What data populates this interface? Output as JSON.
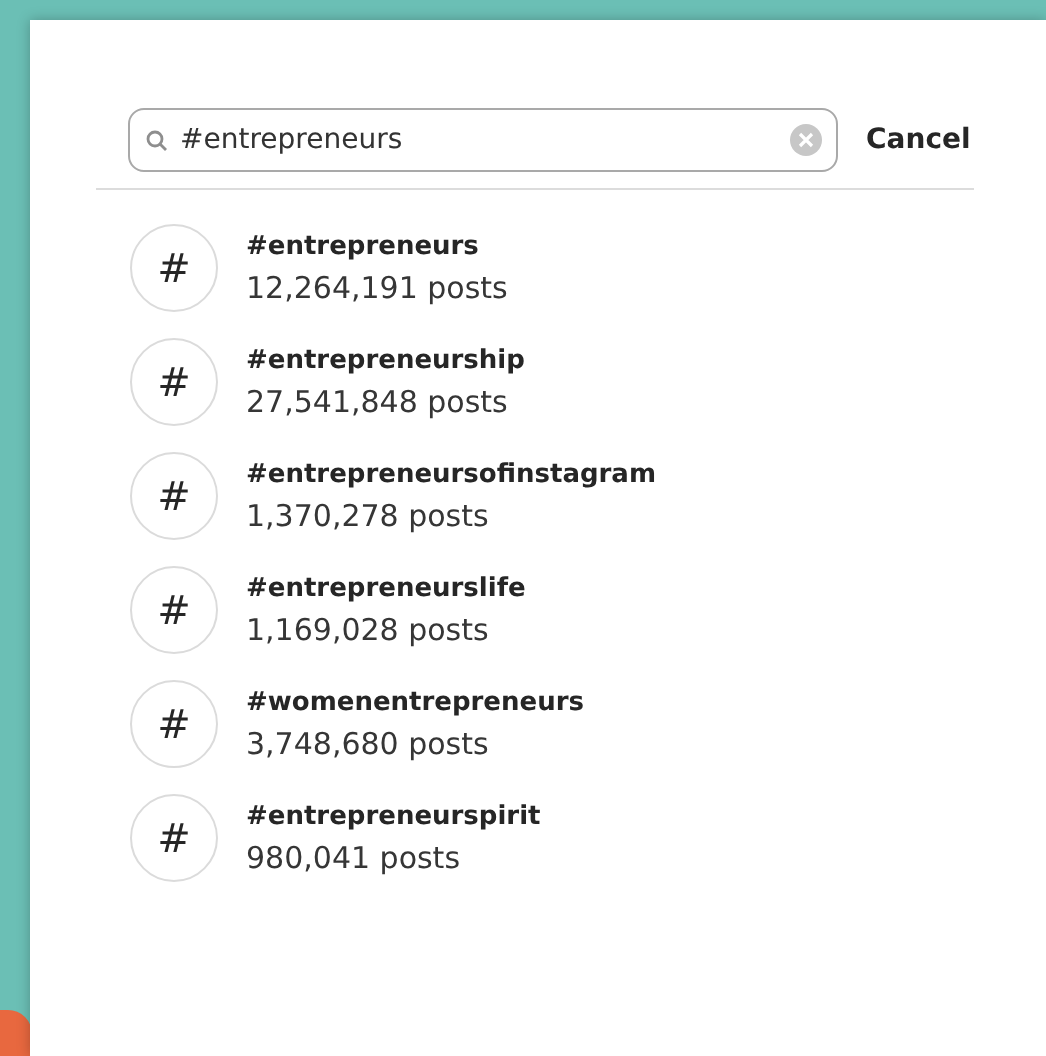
{
  "search": {
    "value": "#entrepreneurs",
    "cancel": "Cancel"
  },
  "results": [
    {
      "symbol": "#",
      "tag": "#entrepreneurs",
      "posts": "12,264,191 posts"
    },
    {
      "symbol": "#",
      "tag": "#entrepreneurship",
      "posts": "27,541,848 posts"
    },
    {
      "symbol": "#",
      "tag": "#entrepreneursofinstagram",
      "posts": "1,370,278 posts"
    },
    {
      "symbol": "#",
      "tag": "#entrepreneurslife",
      "posts": "1,169,028 posts"
    },
    {
      "symbol": "#",
      "tag": "#womenentrepreneurs",
      "posts": "3,748,680 posts"
    },
    {
      "symbol": "#",
      "tag": "#entrepreneurspirit",
      "posts": "980,041 posts"
    }
  ]
}
